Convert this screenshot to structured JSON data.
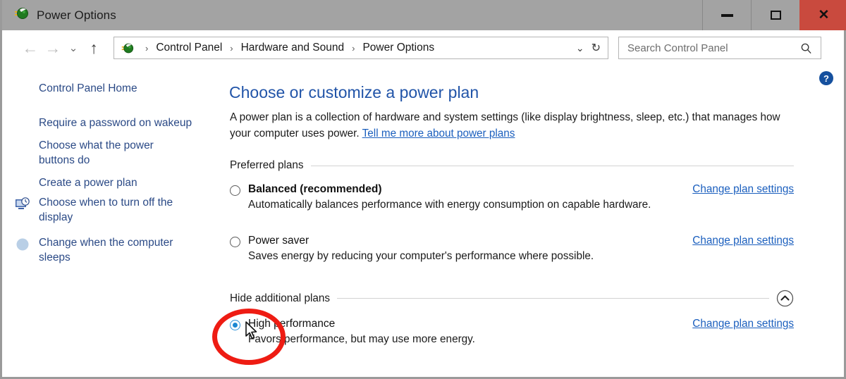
{
  "window": {
    "title": "Power Options",
    "app_icon": "power-plug-icon",
    "controls": {
      "minimize": "minimize-icon",
      "maximize": "maximize-icon",
      "close": "✕"
    }
  },
  "navigation": {
    "back": "←",
    "forward": "→",
    "recent": "⌄",
    "up": "↑",
    "address_icon": "power-plug-icon",
    "breadcrumbs": [
      "Control Panel",
      "Hardware and Sound",
      "Power Options"
    ],
    "separator": "›",
    "dropdown": "⌄",
    "refresh": "↻",
    "search": {
      "placeholder": "Search Control Panel",
      "icon": "search-icon"
    }
  },
  "sidebar": {
    "home": "Control Panel Home",
    "items": [
      {
        "label": "Require a password on wakeup",
        "icon": null
      },
      {
        "label": "Choose what the power buttons do",
        "icon": null
      },
      {
        "label": "Create a power plan",
        "icon": null
      },
      {
        "label": "Choose when to turn off the display",
        "icon": "monitor-clock-icon"
      },
      {
        "label": "Change when the computer sleeps",
        "icon": "moon-sleep-icon"
      }
    ]
  },
  "help": {
    "icon": "help-question-icon",
    "glyph": "?"
  },
  "main": {
    "title": "Choose or customize a power plan",
    "description_part1": "A power plan is a collection of hardware and system settings (like display brightness, sleep, etc.) that manages how your computer uses power. ",
    "description_link": "Tell me more about power plans",
    "sections": [
      {
        "label": "Preferred plans",
        "collapsible": false,
        "plans": [
          {
            "name": "Balanced (recommended)",
            "bold": true,
            "selected": false,
            "description": "Automatically balances performance with energy consumption on capable hardware.",
            "link": "Change plan settings"
          },
          {
            "name": "Power saver",
            "bold": false,
            "selected": false,
            "description": "Saves energy by reducing your computer's performance where possible.",
            "link": "Change plan settings"
          }
        ]
      },
      {
        "label": "Hide additional plans",
        "collapsible": true,
        "collapse_icon": "chevron-up-circle-icon",
        "plans": [
          {
            "name": "High performance",
            "bold": false,
            "selected": true,
            "description": "Favors performance, but may use more energy.",
            "link": "Change plan settings"
          }
        ]
      }
    ]
  },
  "annotation": {
    "highlight_shape": "red-ellipse",
    "highlight_color": "#ee1c13",
    "cursor": "mouse-pointer-icon",
    "target": "High performance radio button"
  },
  "colors": {
    "titlebar": "#a3a3a3",
    "close_button": "#c94a3e",
    "link": "#1b5fbe",
    "heading": "#2154a8",
    "sidebar_link": "#2b4a86",
    "radio_selected": "#1b87d2"
  }
}
